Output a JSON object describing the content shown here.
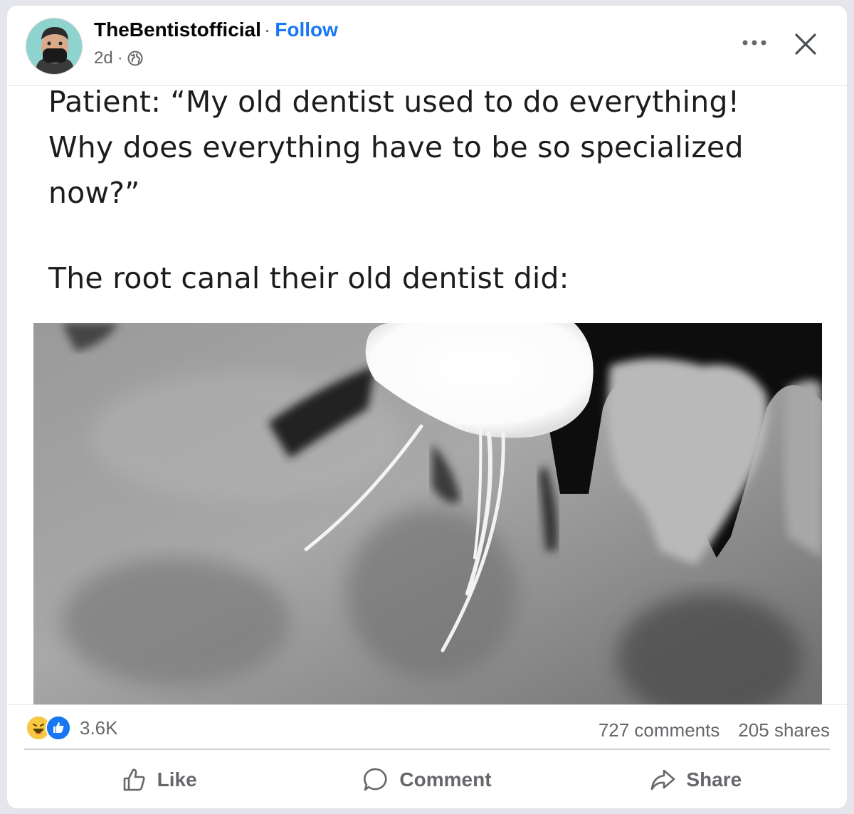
{
  "post": {
    "author": "TheBentistofficial",
    "follow_label": "Follow",
    "separator": "·",
    "time": "2d",
    "privacy_icon": "globe-icon"
  },
  "header_actions": {
    "more_icon": "more-options-icon",
    "close_icon": "close-icon"
  },
  "meme": {
    "line1": "Patient: “My old dentist used to do everything! Why does everything have to be so specialized now?”",
    "line2": "The root canal their old dentist did:"
  },
  "stats": {
    "reaction_icons": [
      "haha-icon",
      "like-icon"
    ],
    "reaction_count": "3.6K",
    "comments": "727 comments",
    "shares": "205 shares"
  },
  "actions": {
    "like": "Like",
    "comment": "Comment",
    "share": "Share"
  },
  "colors": {
    "link_blue": "#1877f2",
    "secondary_text": "#65676b",
    "like_blue": "#1877f2",
    "haha_yellow": "#f7c844"
  }
}
